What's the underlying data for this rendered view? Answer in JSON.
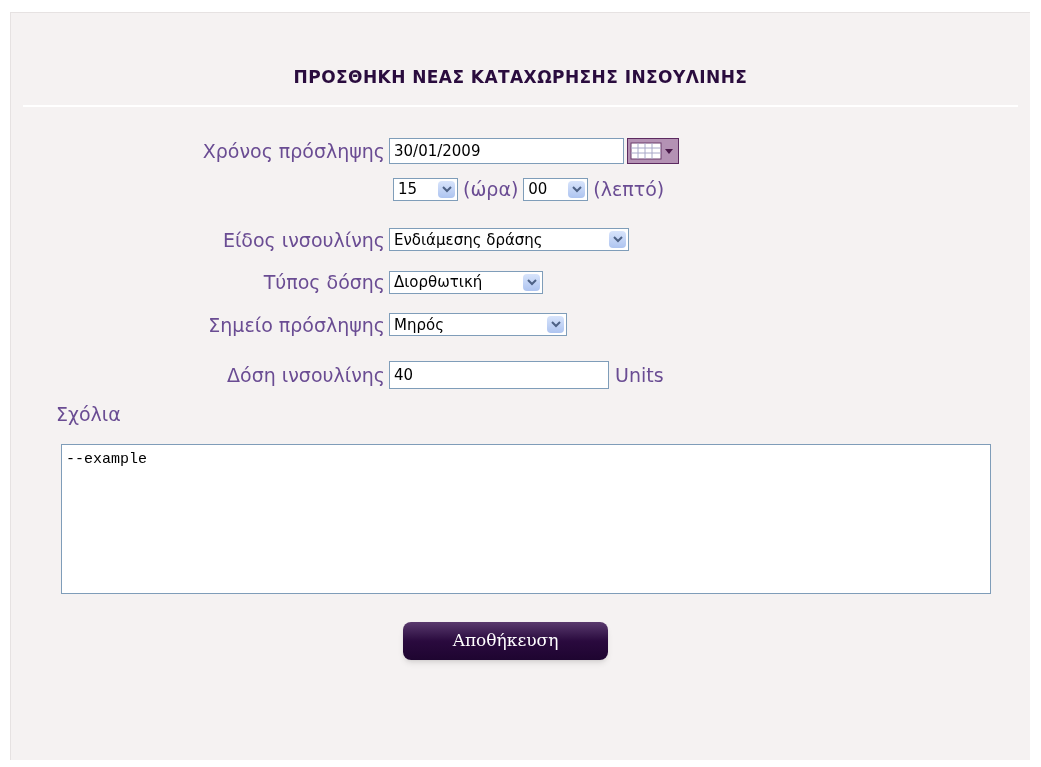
{
  "title": "ΠΡΟΣΘΗΚΗ ΝΕΑΣ ΚΑΤΑΧΩΡΗΣΗΣ ΙΝΣΟΥΛΙΝΗΣ",
  "time": {
    "label": "Χρόνος πρόσληψης",
    "date": "30/01/2009",
    "hour": "15",
    "hour_label": "(ώρα)",
    "minute": "00",
    "minute_label": "(λεπτό)"
  },
  "selects": [
    {
      "label": "Είδος ινσουλίνης",
      "value": "Ενδιάμεσης δράσης"
    },
    {
      "label": "Τύπος δόσης",
      "value": "Διορθωτική"
    },
    {
      "label": "Σημείο πρόσληψης",
      "value": "Μηρός"
    }
  ],
  "dose": {
    "label": "Δόση ινσουλίνης",
    "value": "40",
    "unit": "Units"
  },
  "comments": {
    "label": "Σχόλια",
    "value": "--example"
  },
  "save_button": "Αποθήκευση"
}
